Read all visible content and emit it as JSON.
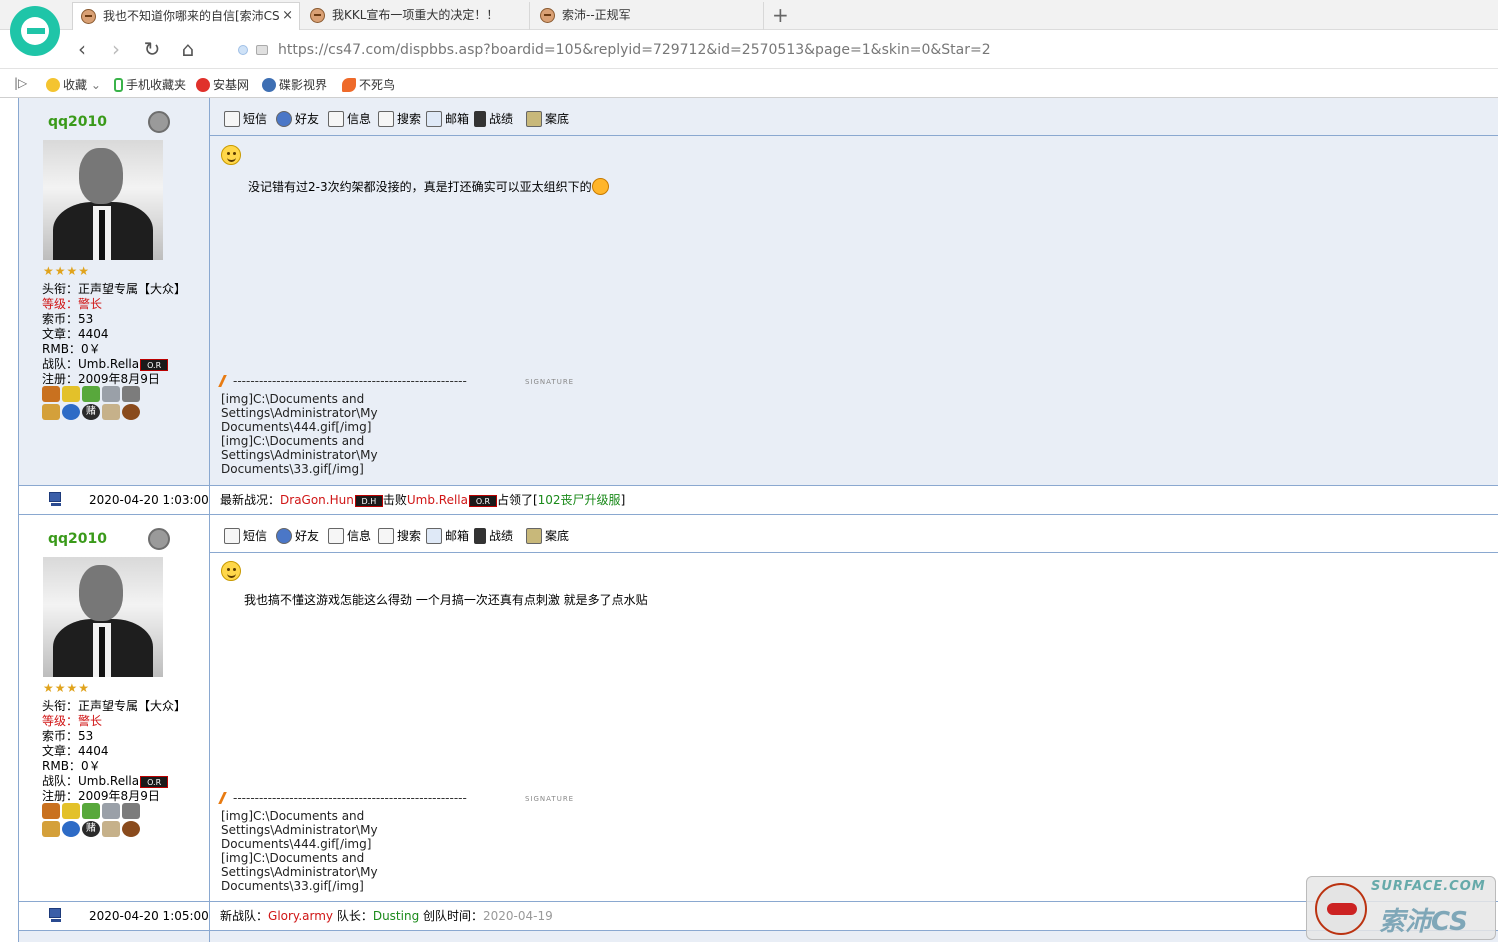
{
  "browser": {
    "tabs": [
      {
        "title": "我也不知道你哪来的自信[索沛CS",
        "active": true
      },
      {
        "title": "我KKL宣布一项重大的决定！！",
        "active": false
      },
      {
        "title": "索沛--正规军",
        "active": false
      }
    ],
    "close_glyph": "×",
    "new_tab_glyph": "+",
    "url": "https://cs47.com/dispbbs.asp?boardid=105&replyid=729712&id=2570513&page=1&skin=0&Star=2",
    "bookmarks_toggle": "|▷",
    "bookmarks": [
      "收藏",
      "手机收藏夹",
      "安基网",
      "碟影视界",
      "不死鸟"
    ],
    "bookmark_dropdown": "⌄"
  },
  "toolbar_labels": {
    "sms": "短信",
    "friend": "好友",
    "info": "信息",
    "search": "搜索",
    "mail": "邮箱",
    "record": "战绩",
    "case": "案底"
  },
  "posts": [
    {
      "username": "qq2010",
      "stars": "★★★★",
      "title_label": "头衔：",
      "title_value": "正声望专属【大众】",
      "level_label": "等级：",
      "level_value": "警长",
      "coins_label": "索币：",
      "coins_value": "53",
      "articles_label": "文章：",
      "articles_value": "4404",
      "rmb_label": "RMB：",
      "rmb_value": "0￥",
      "team_label": "战队：",
      "team_value": "Umb.Rella",
      "team_tag": "O.R",
      "reg_label": "注册：",
      "reg_value": "2009年8月9日",
      "medal_badge": "赌",
      "message": "没记错有过2-3次约架都没接的，真是打还确实可以亚太组织下的",
      "sig_dashes": "------------------------------------------------------",
      "sig_label": "SIGNATURE",
      "signature": [
        "[img]C:\\Documents and",
        "Settings\\Administrator\\My",
        "Documents\\444.gif[/img]",
        "[img]C:\\Documents and",
        "Settings\\Administrator\\My",
        "Documents\\33.gif[/img]"
      ],
      "time": "2020-04-20 1:03:00",
      "footer": {
        "prefix": "最新战况：",
        "team1": "DraGon.Hun",
        "team1_tag": "D.H",
        "beat": "击败",
        "team2": "Umb.Rella",
        "team2_tag": "O.R",
        "occupy": "占领了[",
        "server": "102丧尸升级服",
        "suffix": "]"
      }
    },
    {
      "username": "qq2010",
      "stars": "★★★★",
      "title_label": "头衔：",
      "title_value": "正声望专属【大众】",
      "level_label": "等级：",
      "level_value": "警长",
      "coins_label": "索币：",
      "coins_value": "53",
      "articles_label": "文章：",
      "articles_value": "4404",
      "rmb_label": "RMB：",
      "rmb_value": "0￥",
      "team_label": "战队：",
      "team_value": "Umb.Rella",
      "team_tag": "O.R",
      "reg_label": "注册：",
      "reg_value": "2009年8月9日",
      "medal_badge": "赌",
      "message": "我也搞不懂这游戏怎能这么得劲  一个月搞一次还真有点刺激  就是多了点水贴",
      "sig_dashes": "------------------------------------------------------",
      "sig_label": "SIGNATURE",
      "signature": [
        "[img]C:\\Documents and",
        "Settings\\Administrator\\My",
        "Documents\\444.gif[/img]",
        "[img]C:\\Documents and",
        "Settings\\Administrator\\My",
        "Documents\\33.gif[/img]"
      ],
      "time": "2020-04-20 1:05:00",
      "footer": {
        "prefix": "新战队：",
        "team": "Glory.army",
        "leader_label": " 队长：",
        "leader": "Dusting",
        "created_label": " 创队时间：",
        "created": "2020-04-19"
      }
    }
  ],
  "watermark": {
    "line1": "SURFACE.COM",
    "line2": "索沛CS"
  }
}
